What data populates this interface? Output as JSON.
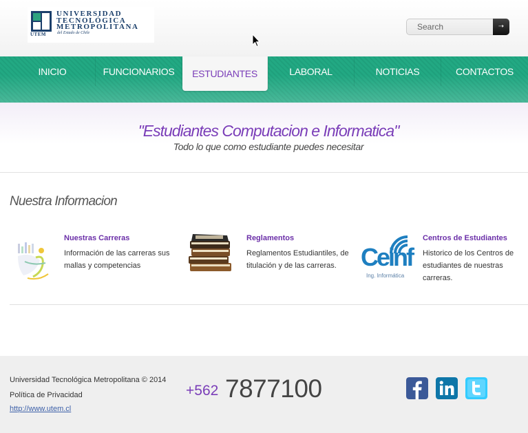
{
  "header": {
    "logo": {
      "text_lines": [
        "UNIVERSIDAD",
        "TECNOLÓGICA",
        "METROPOLITANA"
      ],
      "subtitle": "del Estado de Chile",
      "acronym": "UTEM"
    },
    "search": {
      "placeholder": "Search",
      "button_icon": "arrow-right-icon"
    }
  },
  "nav": {
    "items": [
      {
        "label": "INICIO",
        "active": false
      },
      {
        "label": "FUNCIONARIOS",
        "active": false
      },
      {
        "label": "ESTUDIANTES",
        "active": true
      },
      {
        "label": "LABORAL",
        "active": false
      },
      {
        "label": "NOTICIAS",
        "active": false
      },
      {
        "label": "CONTACTOS",
        "active": false
      }
    ]
  },
  "hero": {
    "title": "\"Estudiantes Computacion e Informatica\"",
    "subtitle": "Todo lo que como estudiante puedes necesitar"
  },
  "info": {
    "title": "Nuestra Informacion",
    "cards": [
      {
        "title": "Nuestras Carreras",
        "text_lines": [
          "Información de las carreras sus",
          "mallas y competencias"
        ],
        "icon": "career-chart-icon"
      },
      {
        "title": "Reglamentos",
        "text_lines": [
          "Reglamentos Estudiantiles, de",
          "titulación y de las carreras."
        ],
        "icon": "books-icon"
      },
      {
        "title": "Centros de Estudiantes",
        "text_lines": [
          "Historico de los Centros de",
          "estudiantes de nuestras",
          "carreras."
        ],
        "icon": "ceinf-logo-icon",
        "logo_text": "Ceinf",
        "logo_caption": "Ing. Informática"
      }
    ]
  },
  "footer": {
    "copyright": "Universidad Tecnológica Metropolitana © 2014",
    "privacy": "Política de Privacidad",
    "link": "http://www.utem.cl",
    "phone_prefix": "+562",
    "phone_number": "7877100",
    "social": [
      {
        "name": "facebook",
        "icon": "facebook-icon",
        "color": "#3b5998"
      },
      {
        "name": "linkedin",
        "icon": "linkedin-icon",
        "color": "#0e76a8"
      },
      {
        "name": "twitter",
        "icon": "twitter-icon",
        "color": "#33ccff"
      }
    ]
  },
  "colors": {
    "nav_green": "#22a983",
    "accent_purple": "#7a3db8"
  }
}
